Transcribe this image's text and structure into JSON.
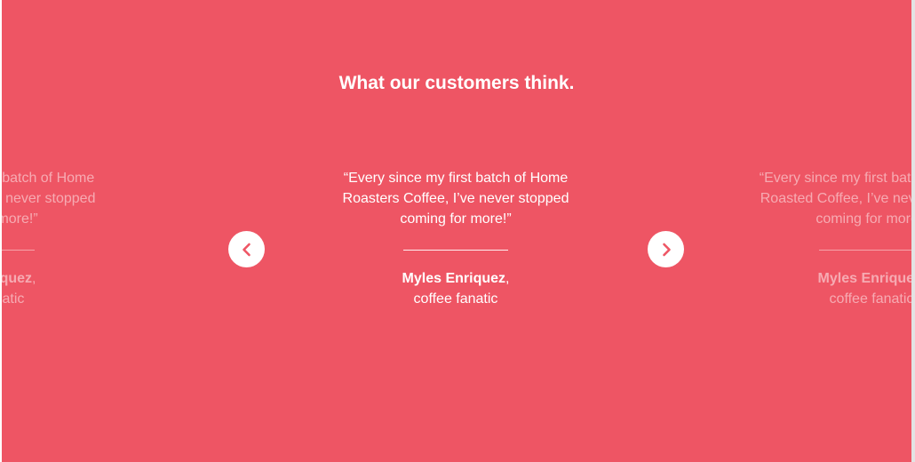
{
  "section": {
    "title": "What our customers think."
  },
  "testimonials": [
    {
      "quote": "“Every since my first batch of Home Roasters Coffee, I’ve never stopped coming for more!”",
      "author": "Myles Enriquez",
      "separator": ",",
      "role": "coffee fanatic"
    },
    {
      "quote": "“Every since my first batch of Home Roasters Coffee, I’ve never stopped coming for more!”",
      "author": "Myles Enriquez",
      "separator": ",",
      "role": "coffee fanatic"
    },
    {
      "quote": "“Every since my first batch of Home Roasted Coffee, I’ve never stopped coming for more!”",
      "author": "Myles Enriquez",
      "separator": ",",
      "role": "coffee fanatic"
    }
  ],
  "controls": {
    "prev_icon": "chevron-left-icon",
    "next_icon": "chevron-right-icon"
  },
  "colors": {
    "background": "#ee5564",
    "text": "#ffffff",
    "arrow": "#ee5564"
  }
}
